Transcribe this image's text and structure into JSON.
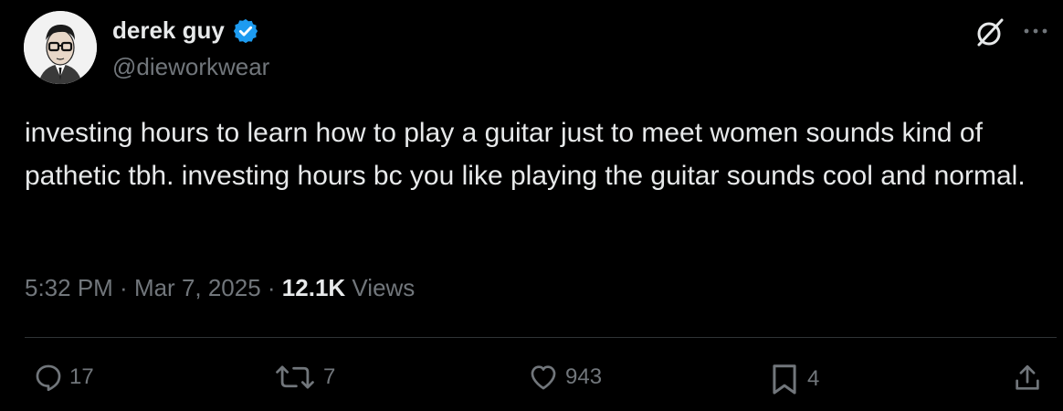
{
  "author": {
    "display_name": "derek guy",
    "handle": "@dieworkwear",
    "verified": true
  },
  "tweet": {
    "text": "investing hours to learn how to play a guitar just to meet women sounds kind of pathetic tbh. investing hours bc you like playing the guitar sounds cool and normal.",
    "time": "5:32 PM",
    "separator": " · ",
    "date": "Mar 7, 2025",
    "views_count": "12.1K",
    "views_label": "Views"
  },
  "actions": {
    "replies": "17",
    "reposts": "7",
    "likes": "943",
    "bookmarks": "4"
  },
  "icons": [
    "verified-badge-icon",
    "grok-icon",
    "more-icon",
    "reply-icon",
    "repost-icon",
    "like-icon",
    "bookmark-icon",
    "share-icon"
  ],
  "colors": {
    "background": "#000000",
    "text": "#e7e9ea",
    "secondary_text": "#71767b",
    "verified": "#1d9bf0",
    "divider": "#2f3336"
  }
}
